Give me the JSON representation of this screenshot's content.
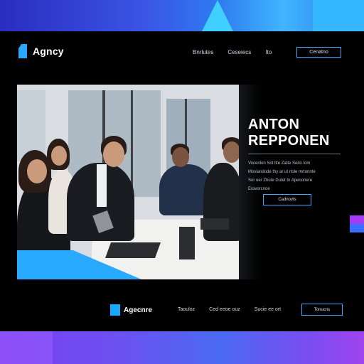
{
  "header": {
    "logo_text": "Agncy",
    "logo_icon": "brand-logo-icon",
    "nav": [
      "Bnrlutes",
      "Ceseiecs",
      "Ito"
    ],
    "cta_label": "Cenatno"
  },
  "hero": {
    "title_line1": "ANTON",
    "title_line2": "REPPONEN",
    "body_lines": [
      "Vocenlon Sot ltte Zatte Seito Iom",
      "Moviandode thy ar ut rtole mrtonnte",
      "Sor oer Zhute Dutet tn Apenonere",
      "Eravorcnoe"
    ],
    "cta_label": "Cadnovts"
  },
  "footer": {
    "logo_text": "Agecnre",
    "nav": [
      "Taouloz",
      "Ced eeoe ouz",
      "Sucie ee ort"
    ],
    "cta_label": "Tonucns"
  },
  "colors": {
    "accent_blue": "#29a9ff",
    "accent_purple": "#a43cf5",
    "background": "#000000"
  }
}
